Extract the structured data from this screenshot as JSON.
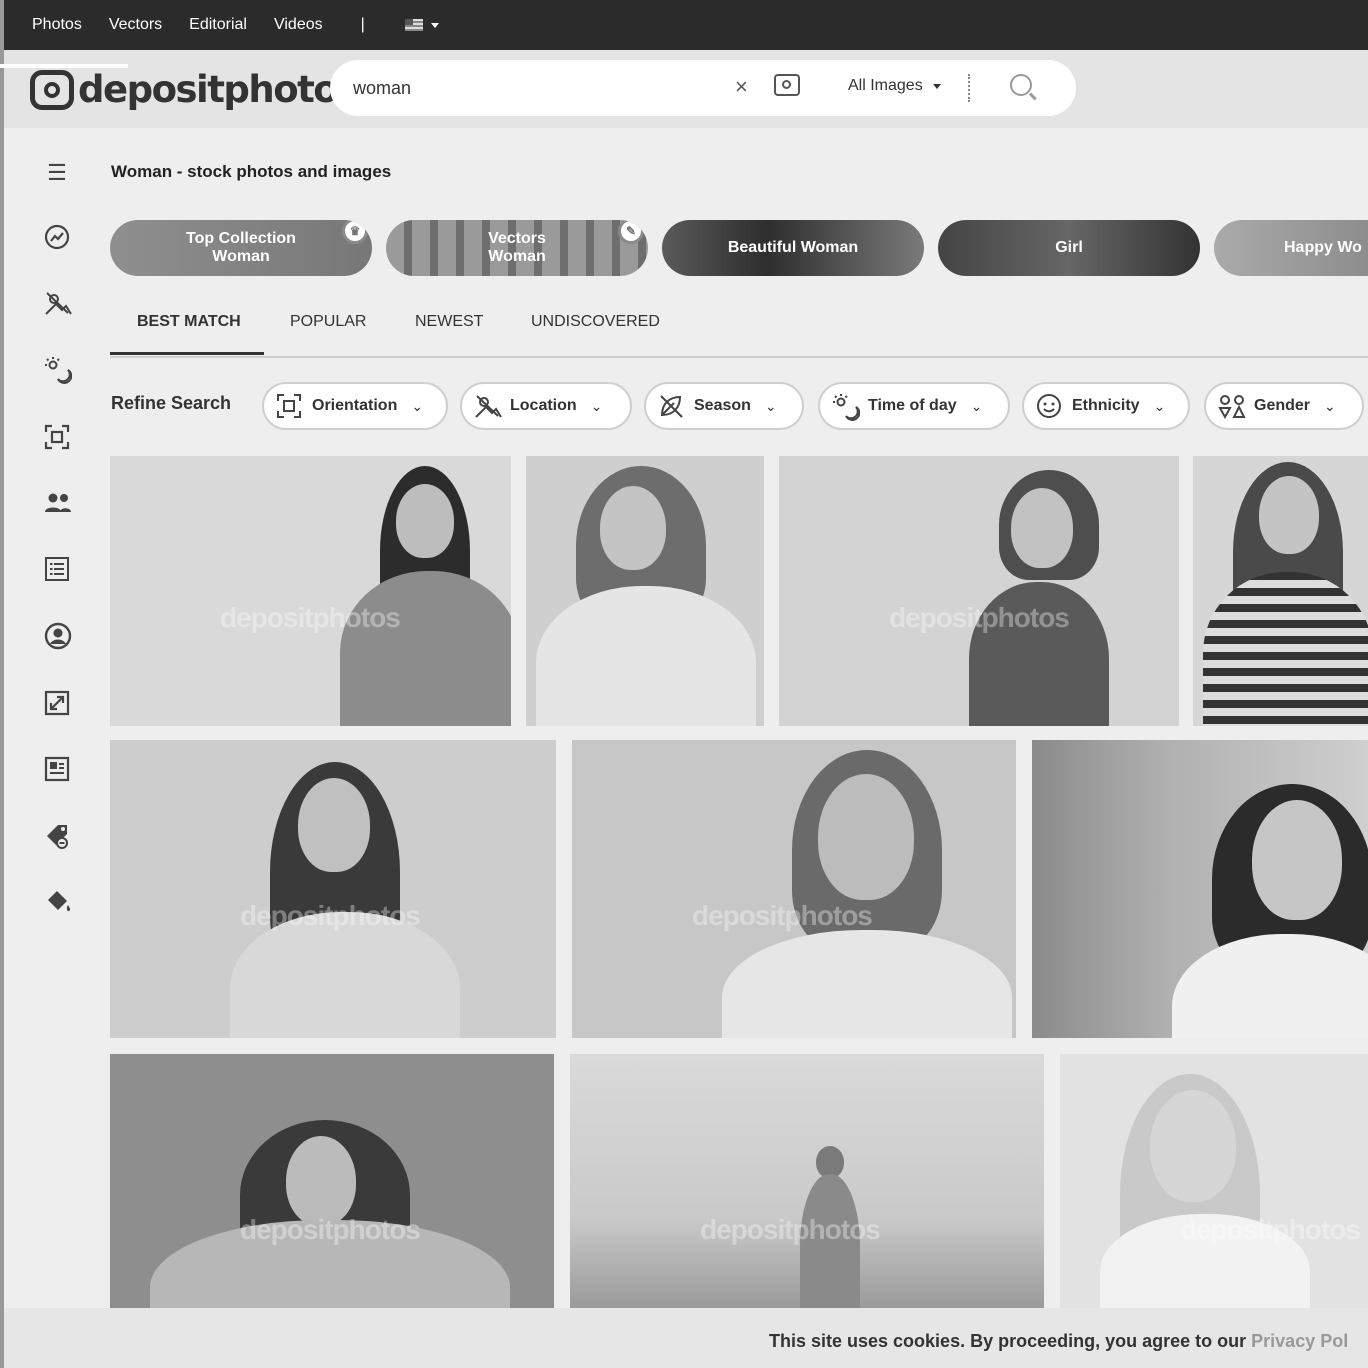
{
  "topnav": {
    "items": [
      "Photos",
      "Vectors",
      "Editorial",
      "Videos"
    ],
    "separator": "|"
  },
  "logo": {
    "text": "depositphotos",
    "reg": "®"
  },
  "search": {
    "value": "woman",
    "clear": "×",
    "filter_label": "All Images"
  },
  "page_title": "Woman - stock photos and images",
  "collections": [
    {
      "label": "Top Collection Woman",
      "badge": "♛"
    },
    {
      "label": "Vectors Woman",
      "badge": "✎"
    },
    {
      "label": "Beautiful Woman"
    },
    {
      "label": "Girl"
    },
    {
      "label": "Happy Wo"
    }
  ],
  "tabs": [
    "BEST MATCH",
    "POPULAR",
    "NEWEST",
    "UNDISCOVERED"
  ],
  "refine": {
    "label": "Refine Search",
    "filters": [
      {
        "label": "Orientation",
        "icon": "orientation-icon"
      },
      {
        "label": "Location",
        "icon": "location-icon"
      },
      {
        "label": "Season",
        "icon": "season-icon"
      },
      {
        "label": "Time of day",
        "icon": "time-of-day-icon"
      },
      {
        "label": "Ethnicity",
        "icon": "ethnicity-icon"
      },
      {
        "label": "Gender",
        "icon": "gender-icon"
      }
    ]
  },
  "sidebar_icons": [
    "menu-icon",
    "trending-icon",
    "location-icon",
    "time-of-day-icon",
    "orientation-icon",
    "people-icon",
    "list-icon",
    "user-icon",
    "resize-icon",
    "article-icon",
    "tag-icon",
    "paint-bucket-icon"
  ],
  "watermark": "depositphotos",
  "cookie": {
    "text": "This site uses cookies. By proceeding, you agree to our",
    "link": "Privacy Pol"
  }
}
